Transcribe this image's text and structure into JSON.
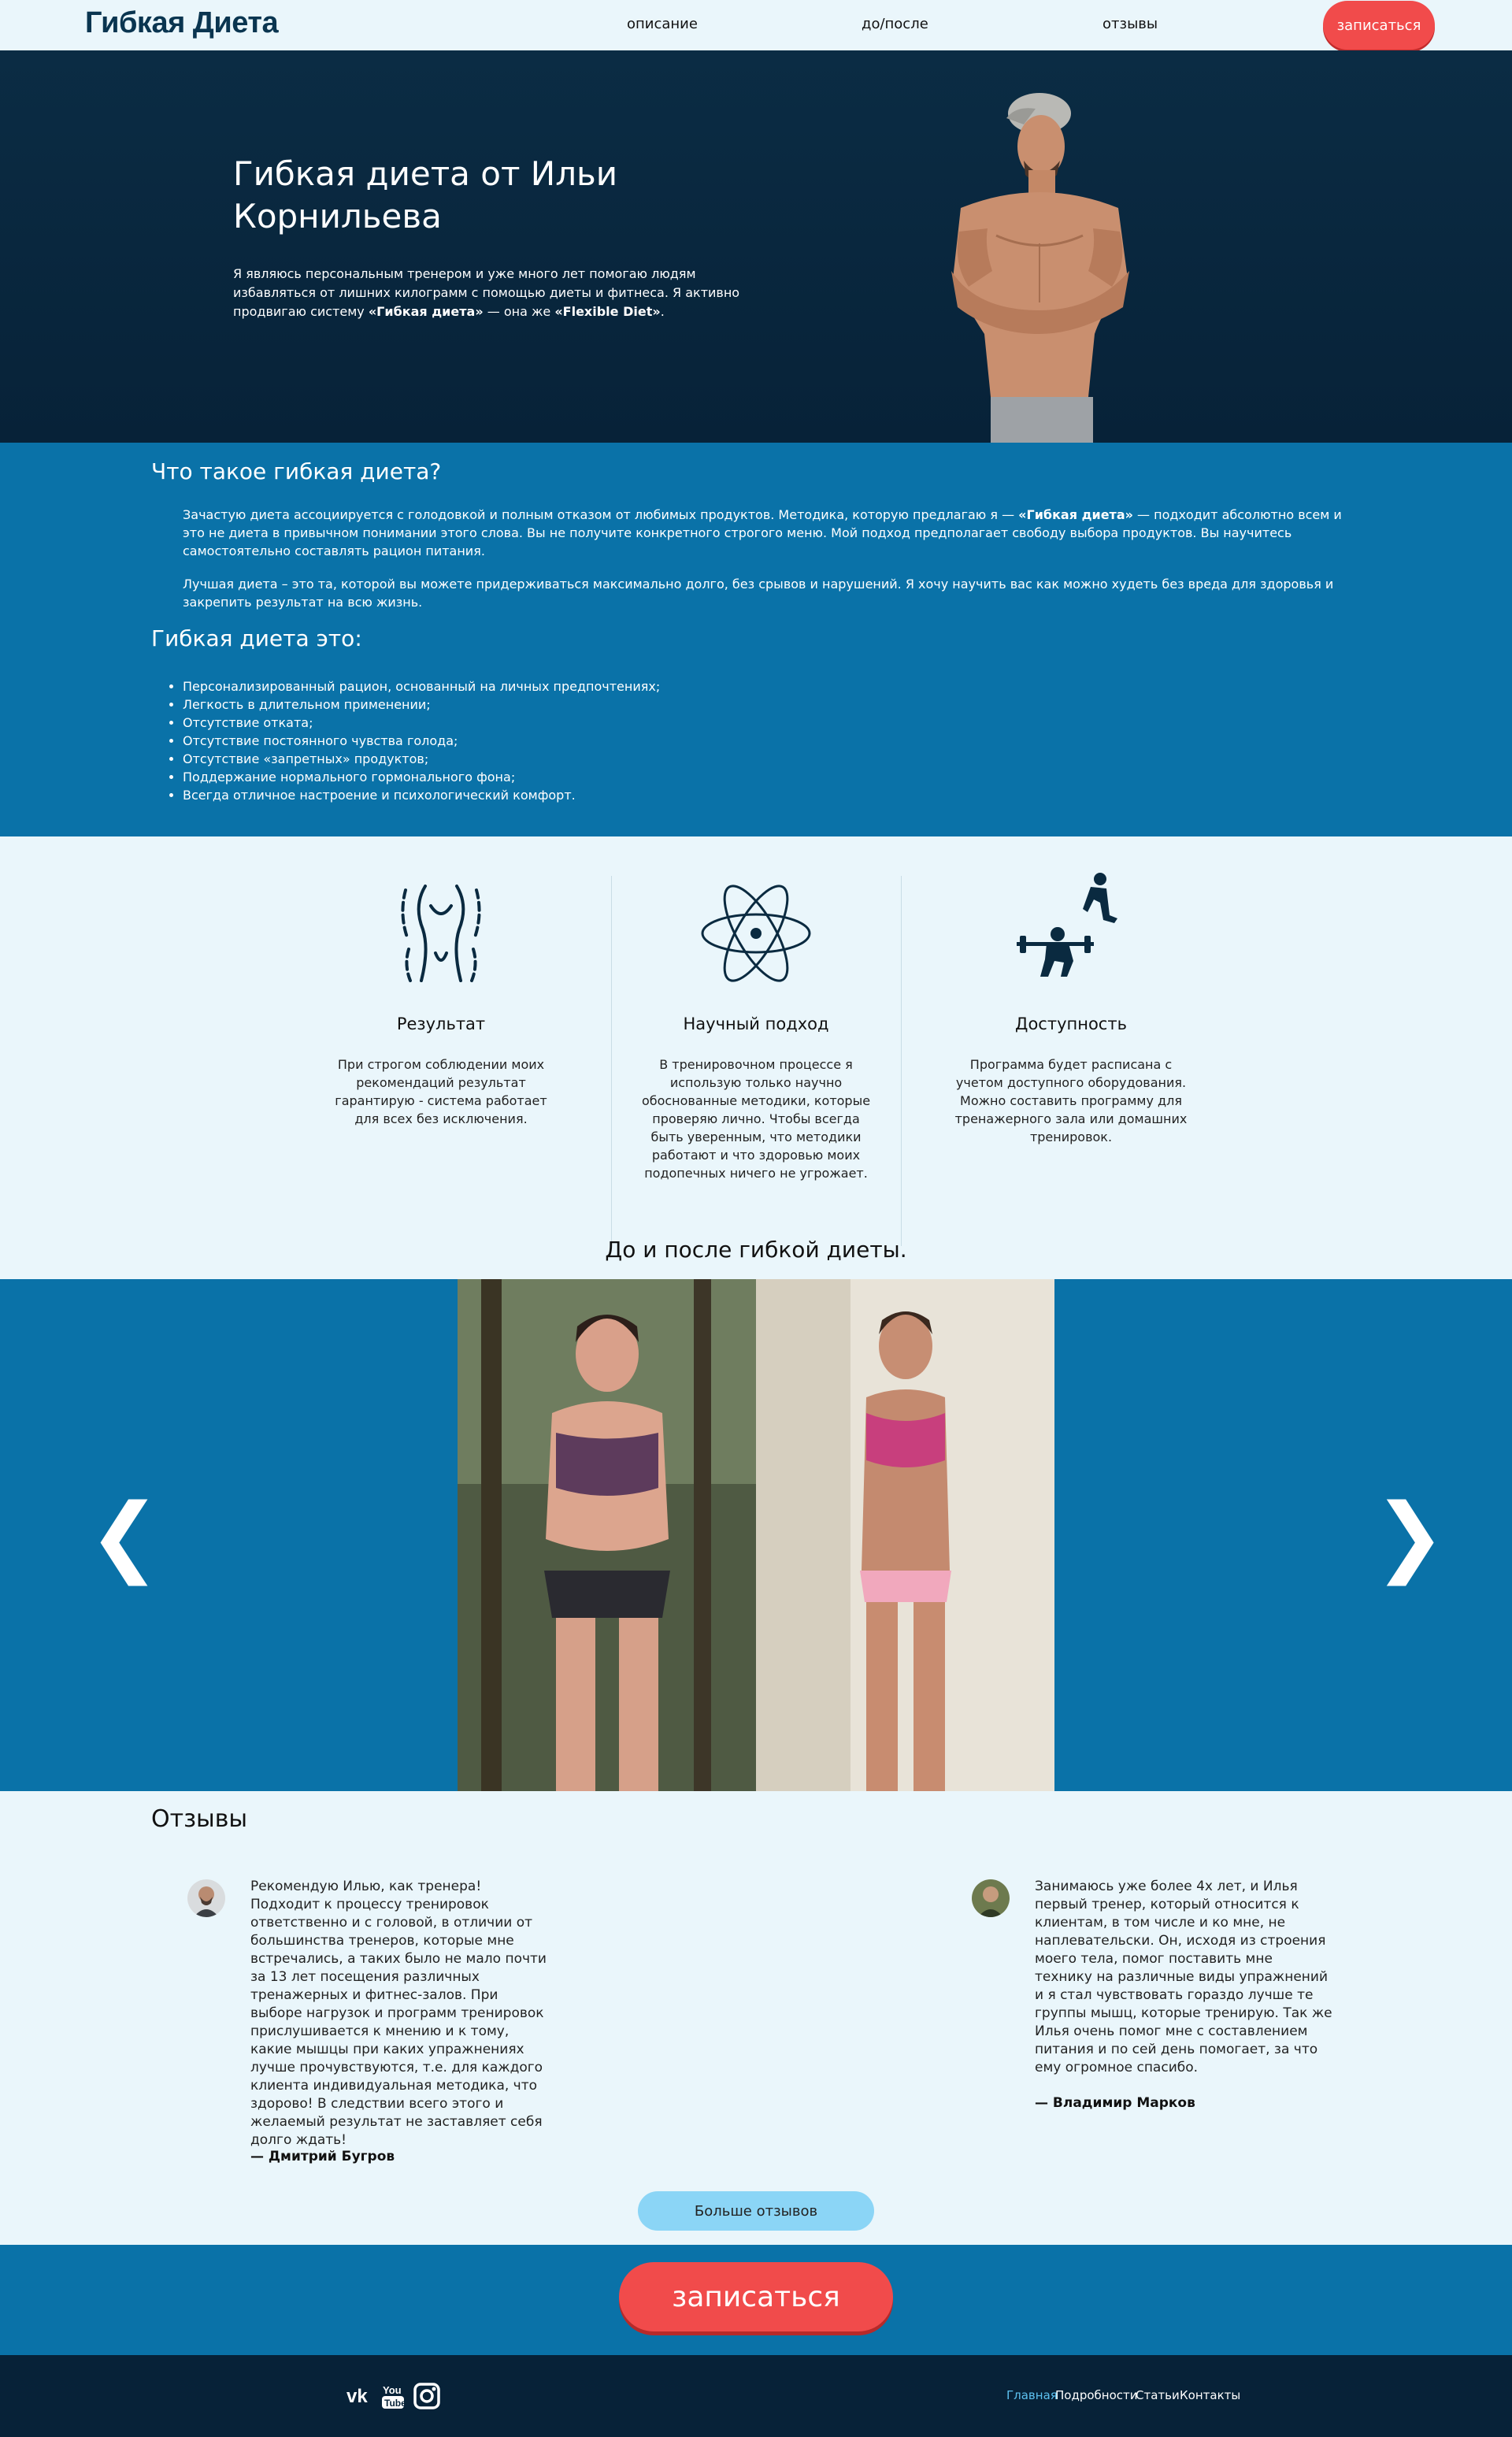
{
  "nav": {
    "logo": "Гибкая Диета",
    "links": [
      "описание",
      "до/после",
      "отзывы"
    ],
    "signup": "записаться"
  },
  "hero": {
    "title": "Гибкая диета от Ильи Корнильева",
    "text_1": "Я являюсь персональным тренером и уже много лет помогаю людям избавляться от лишних килограмм с помощью диеты и фитнеса. Я активно продвигаю систему ",
    "text_bold_1": "«Гибкая диета»",
    "text_2": " — она же ",
    "text_bold_2": "«Flexible Diet»",
    "text_3": "."
  },
  "whatis": {
    "title": "Что такое гибкая диета?",
    "p1_a": "Зачастую диета ассоциируется с голодовкой и полным отказом от любимых продуктов. Методика, которую предлагаю я — ",
    "p1_bold": "«Гибкая диета»",
    "p1_b": " — подходит абсолютно всем и это не диета в привычном понимании этого слова. Вы не получите конкретного строгого меню. Мой подход предполагает свободу выбора продуктов. Вы научитесь самостоятельно составлять рацион питания.",
    "p2": "Лучшая диета – это та, которой вы можете придерживаться максимально долго, без срывов и нарушений. Я хочу научить вас как можно худеть без вреда для здоровья и закрепить результат на всю жизнь.",
    "title2": "Гибкая диета это:",
    "benefits": [
      "Персонализированный рацион, основанный на личных предпочтениях;",
      "Легкость в длительном применении;",
      "Отсутствие отката;",
      "Отсутствие постоянного чувства голода;",
      "Отсутствие «запретных» продуктов;",
      "Поддержание нормального гормонального фона;",
      "Всегда отличное настроение и психологический комфорт."
    ]
  },
  "features": [
    {
      "title": "Результат",
      "text": "При строгом соблюдении моих рекомендаций результат гарантирую - система работает для всех без исключения.",
      "icon": "body-shape-icon"
    },
    {
      "title": "Научный подход",
      "text": "В тренировочном процессе я использую только научно обоснованные методики, которые проверяю лично. Чтобы всегда быть уверенным, что методики работают и что здоровью моих подопечных ничего не угрожает.",
      "icon": "atom-icon"
    },
    {
      "title": "Доступность",
      "text": "Программа будет расписана с учетом доступного оборудования. Можно составить программу для тренажерного зала или домашних тренировок.",
      "icon": "workout-icon"
    }
  ],
  "before_after": {
    "title": "До и после гибкой диеты.",
    "prev": "❮",
    "next": "❯"
  },
  "reviews": {
    "title": "Отзывы",
    "items": [
      {
        "text": "Рекомендую Илью, как тренера! Подходит к процессу тренировок ответственно и с головой, в отличии от большинства тренеров, которые мне встречались, а таких было не мало почти за 13 лет посещения различных тренажерных и фитнес-залов. При выборе нагрузок и программ тренировок прислушивается к мнению и к тому, какие мышцы при каких упражнениях лучше прочувствуются, т.е. для каждого клиента индивидуальная методика, что здорово! В следствии всего этого и желаемый результат не заставляет себя долго ждать!",
        "author": "— Дмитрий Бугров"
      },
      {
        "text": "Занимаюсь уже более 4х лет, и Илья первый тренер, который относится к клиентам, в том числе и ко мне, не наплевательски. Он, исходя из строения моего тела, помог поставить мне технику на различные виды упражнений и я стал чувствовать гораздо лучше те группы мышц, которые тренирую. Так же Илья очень помог мне с составлением питания и по сей день помогает, за что ему огромное спасибо.",
        "author": "— Владимир Марков"
      }
    ],
    "more": "Больше отзывов"
  },
  "cta": {
    "label": "записаться"
  },
  "footer": {
    "social": [
      "vk-icon",
      "youtube-icon",
      "instagram-icon"
    ],
    "links": [
      "Главная",
      "Подробности",
      "Статьи",
      "Контакты"
    ]
  }
}
